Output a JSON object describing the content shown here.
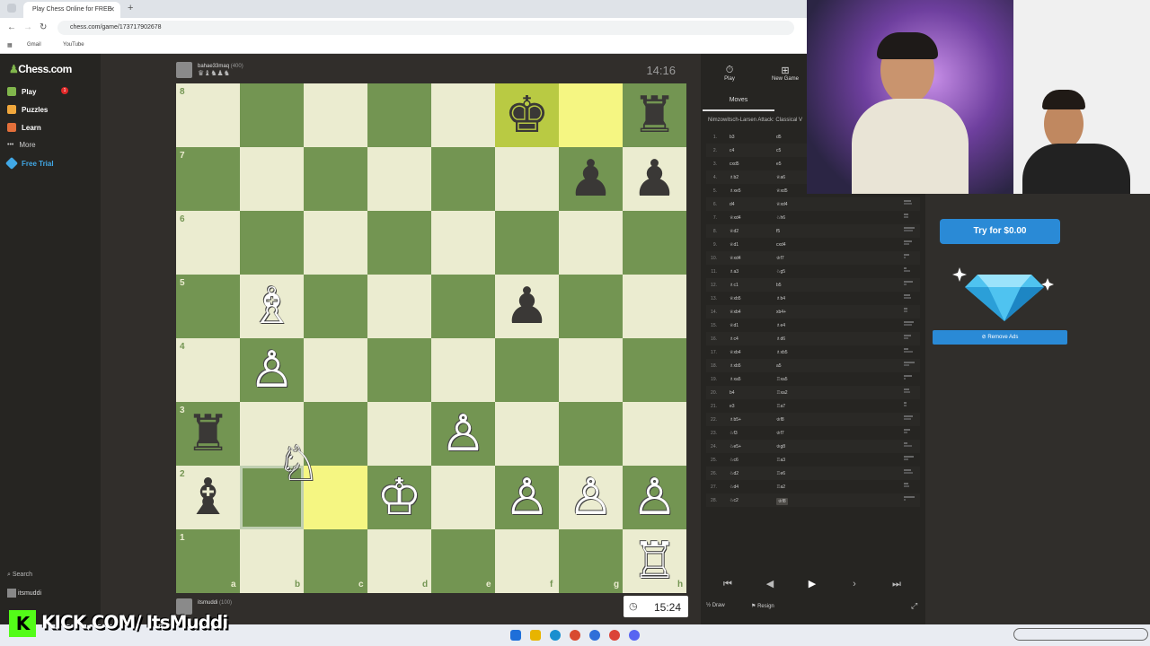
{
  "browser": {
    "tab_title": "Play Chess Online for FREE",
    "new_tab_icon": "plus-icon",
    "url": "chess.com/game/173717902678",
    "bookmarks": [
      "Gmail",
      "YouTube"
    ]
  },
  "sidebar": {
    "logo": "Chess.com",
    "items": [
      {
        "label": "Play",
        "icon": "play-icon",
        "color": "#81b64c"
      },
      {
        "label": "Puzzles",
        "icon": "puzzle-icon",
        "color": "#f0a73c"
      },
      {
        "label": "Learn",
        "icon": "learn-icon",
        "color": "#e36f3a"
      },
      {
        "label": "More",
        "icon": "more-icon",
        "color": "#999999"
      },
      {
        "label": "Free Trial",
        "icon": "diamond-icon",
        "color": "#41a8e6"
      }
    ],
    "play_badge": "1",
    "search_label": "Search",
    "username": "itsmuddi"
  },
  "game": {
    "top_player": {
      "name": "bahae33maq",
      "rating": "(400)",
      "captured": "♛♝♞♟♞"
    },
    "bottom_player": {
      "name": "itsmuddi",
      "rating": "(100)"
    },
    "top_clock": "14:16",
    "bottom_clock": "15:24",
    "ranks": [
      "8",
      "7",
      "6",
      "5",
      "4",
      "3",
      "2",
      "1"
    ],
    "files": [
      "a",
      "b",
      "c",
      "d",
      "e",
      "f",
      "g",
      "h"
    ],
    "highlight_squares": [
      "f8",
      "g8",
      "c2"
    ],
    "pieces": [
      {
        "sq": "f8",
        "p": "♚",
        "c": "black"
      },
      {
        "sq": "h8",
        "p": "♜",
        "c": "black"
      },
      {
        "sq": "g7",
        "p": "♟",
        "c": "black"
      },
      {
        "sq": "h7",
        "p": "♟",
        "c": "black"
      },
      {
        "sq": "b5",
        "p": "♗",
        "c": "white"
      },
      {
        "sq": "f5",
        "p": "♟",
        "c": "black"
      },
      {
        "sq": "b4",
        "p": "♙",
        "c": "white"
      },
      {
        "sq": "a3",
        "p": "♜",
        "c": "black"
      },
      {
        "sq": "e3",
        "p": "♙",
        "c": "white"
      },
      {
        "sq": "a2",
        "p": "♝",
        "c": "black"
      },
      {
        "sq": "d2",
        "p": "♔",
        "c": "white"
      },
      {
        "sq": "f2",
        "p": "♙",
        "c": "white"
      },
      {
        "sq": "g2",
        "p": "♙",
        "c": "white"
      },
      {
        "sq": "h2",
        "p": "♙",
        "c": "white"
      },
      {
        "sq": "h1",
        "p": "♖",
        "c": "white"
      }
    ],
    "dragged_piece": {
      "p": "♘",
      "c": "white",
      "from": "b2"
    }
  },
  "panel": {
    "tabs": [
      {
        "label": "Play",
        "icon": "stopwatch-icon"
      },
      {
        "label": "New Game",
        "icon": "plus-square-icon"
      }
    ],
    "moves_tab": "Moves",
    "opening": "Nimzowitsch-Larsen Attack: Classical V",
    "moves": [
      {
        "n": "1.",
        "w": "b3",
        "b": "d5"
      },
      {
        "n": "2.",
        "w": "c4",
        "b": "c5"
      },
      {
        "n": "3.",
        "w": "cxd5",
        "b": "e5"
      },
      {
        "n": "4.",
        "w": "♗b2",
        "b": "♕a6"
      },
      {
        "n": "5.",
        "w": "♗xe5",
        "b": "♕xd5"
      },
      {
        "n": "6.",
        "w": "d4",
        "b": "♕xd4"
      },
      {
        "n": "7.",
        "w": "♕xd4",
        "b": "♘h6"
      },
      {
        "n": "8.",
        "w": "♕d2",
        "b": "f5"
      },
      {
        "n": "9.",
        "w": "♕d1",
        "b": "cxd4"
      },
      {
        "n": "10.",
        "w": "♕xd4",
        "b": "♔f7"
      },
      {
        "n": "11.",
        "w": "♗a3",
        "b": "♘g5"
      },
      {
        "n": "12.",
        "w": "♗c1",
        "b": "b5"
      },
      {
        "n": "13.",
        "w": "♕xb5",
        "b": "♗b4"
      },
      {
        "n": "14.",
        "w": "♕xb4",
        "b": "xb4+"
      },
      {
        "n": "15.",
        "w": "♕d1",
        "b": "♗e4"
      },
      {
        "n": "16.",
        "w": "♗c4",
        "b": "♗d6"
      },
      {
        "n": "17.",
        "w": "♕xb4",
        "b": "♗xb5"
      },
      {
        "n": "18.",
        "w": "♗xb5",
        "b": "a5"
      },
      {
        "n": "19.",
        "w": "♗xa5",
        "b": "♖xa5"
      },
      {
        "n": "20.",
        "w": "b4",
        "b": "♖xa2"
      },
      {
        "n": "21.",
        "w": "e3",
        "b": "♖a7"
      },
      {
        "n": "22.",
        "w": "♗b5+",
        "b": "♔f8"
      },
      {
        "n": "23.",
        "w": "♘f3",
        "b": "♔f7"
      },
      {
        "n": "24.",
        "w": "♘e5+",
        "b": "♔g8"
      },
      {
        "n": "25.",
        "w": "♘c6",
        "b": "♖a3"
      },
      {
        "n": "26.",
        "w": "♘d2",
        "b": "♖e6"
      },
      {
        "n": "27.",
        "w": "♘d4",
        "b": "♖a2"
      },
      {
        "n": "28.",
        "w": "♘c2",
        "b": "♔f8"
      }
    ],
    "nav_icons": [
      "first-icon",
      "prev-icon",
      "play-icon",
      "next-icon",
      "last-icon"
    ],
    "draw_label": "Draw",
    "resign_label": "Resign",
    "draw_icon": "½"
  },
  "ad": {
    "try_label": "Try for $0.00",
    "remove_ads": "Remove Ads",
    "accent": "#2a8ad6"
  },
  "overlay": {
    "kick_text": "KICK.COM/   ItsMuddi",
    "kick_logo": "K"
  }
}
